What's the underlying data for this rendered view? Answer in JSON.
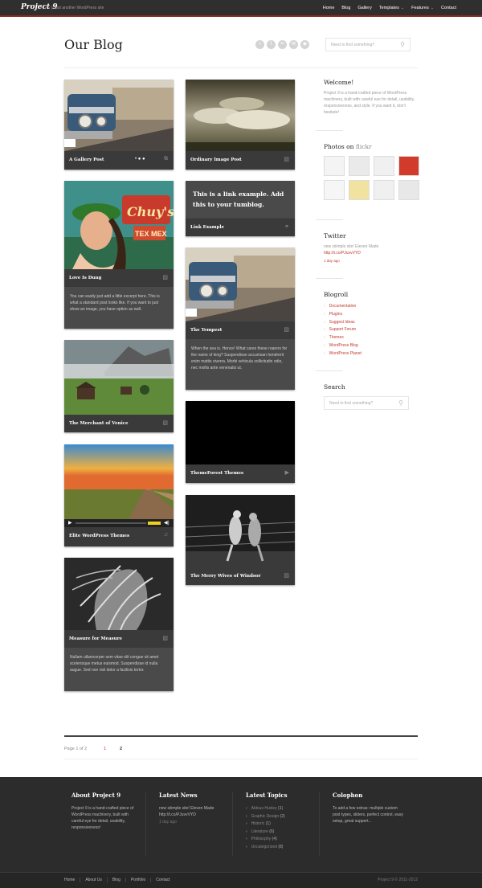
{
  "site": {
    "logo": "Project 9",
    "tagline": "| Just another WordPress site"
  },
  "nav": [
    {
      "label": "Home"
    },
    {
      "label": "Blog"
    },
    {
      "label": "Gallery"
    },
    {
      "label": "Templates",
      "dropdown": true
    },
    {
      "label": "Features",
      "dropdown": true
    },
    {
      "label": "Contact"
    }
  ],
  "header": {
    "title": "Our Blog",
    "social_icons": [
      "twitter-icon",
      "facebook-icon",
      "flickr-icon",
      "email-icon",
      "rss-icon"
    ],
    "search_placeholder": "Need to find something?"
  },
  "posts": {
    "col1": [
      {
        "title": "A Gallery Post",
        "icon": "gallery-icon"
      },
      {
        "title": "Love Is Dung",
        "icon": "image-icon",
        "excerpt": "You can easily just add a little excerpt here. This is what a standard post looks like. If you want to just show an image, you have option as well."
      },
      {
        "title": "The Merchant of Venice",
        "icon": "image-icon"
      },
      {
        "title": "Elite WordPress Themes",
        "icon": "audio-icon"
      },
      {
        "title": "Measure for Measure",
        "icon": "image-icon",
        "excerpt": "Nullam ullamcorper sem vitae elit congue sit amet scelerisque metus euismod. Suspendisse id nulla augue. Sed non nisl dolor a facilisis tortor."
      }
    ],
    "col2": [
      {
        "title": "Ordinary Image Post",
        "icon": "image-icon"
      },
      {
        "title": "Link Example",
        "icon": "link-icon",
        "link_text": "This is a link example. Add this to your tumblog."
      },
      {
        "title": "The Tempest",
        "icon": "image-icon",
        "excerpt": "When the sea is. Hence! What cares these roarers for the name of king? Suspendisse accumsan hendrerit enim mattis viverra. Morbi vehicula sollicitudin odio, nec mollis ante venenatis ut."
      },
      {
        "title": "ThemeForest Themes",
        "icon": "video-icon"
      },
      {
        "title": "The Merry Wives of Windsor",
        "icon": "image-icon"
      }
    ]
  },
  "sidebar": {
    "welcome_title": "Welcome!",
    "welcome_text": "Project 9 is a hand-crafted piece of WordPress machinery, built with careful eye for detail, usability, responsiveness, and style. If you want it, don't hesitate!",
    "flickr_title_a": "Photos on",
    "flickr_title_b": "flickr",
    "twitter_title": "Twitter",
    "tweet_text": "new siiimple site! Eleven Made",
    "tweet_link": "http://t.co/PJuvvVYD",
    "tweet_time": "1 day ago",
    "blogroll_title": "Blogroll",
    "blogroll": [
      "Documentation",
      "Plugins",
      "Suggest Ideas",
      "Support Forum",
      "Themes",
      "WordPress Blog",
      "WordPress Planet"
    ],
    "search_title": "Search",
    "search_placeholder": "Need to find something?"
  },
  "pagination": {
    "label": "Page 1 of 2",
    "pages": [
      "1",
      "2"
    ],
    "current": "2"
  },
  "footer": {
    "about_title": "About Project 9",
    "about_text": "Project 9 is a hand-crafted piece of WordPress machinery, built with careful eye for detail, usability, responsiveness!",
    "news_title": "Latest News",
    "news_text": "new siiimple site! Eleven Made http://t.co/PJuvvVYD",
    "news_time": "1 day ago",
    "topics_title": "Latest Topics",
    "topics": [
      {
        "name": "Aldous Huxley",
        "count": "(1)"
      },
      {
        "name": "Graphic Design",
        "count": "(2)"
      },
      {
        "name": "Historic",
        "count": "(1)"
      },
      {
        "name": "Literature",
        "count": "(6)"
      },
      {
        "name": "Philosophy",
        "count": "(4)"
      },
      {
        "name": "Uncategorized",
        "count": "(8)"
      }
    ],
    "colophon_title": "Colophon",
    "colophon_text": "To add a few extras: multiple custom post types, sliders, perfect control, easy setup, great support...",
    "links": [
      "Home",
      "About Us",
      "Blog",
      "Portfolio",
      "Contact"
    ],
    "copyright": "Project 9 © 2011-2012"
  },
  "colors": {
    "accent": "#c0392b",
    "topbar": "#2f2f2f",
    "card": "#3a3a3a",
    "footer": "#2c2c2c"
  }
}
